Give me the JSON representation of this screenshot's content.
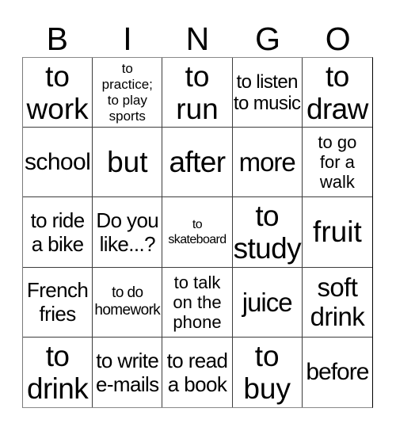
{
  "card": {
    "title": "BINGO",
    "header_letters": [
      "B",
      "I",
      "N",
      "G",
      "O"
    ],
    "colors": {
      "background": "#ffffff",
      "text": "#000000",
      "grid_line": "#3d3d3d"
    },
    "grid": {
      "rows": 5,
      "columns": 5,
      "rows_data": [
        {
          "cells": [
            {
              "text": "to\nwork"
            },
            {
              "text": "to\npractice;\nto play\nsports"
            },
            {
              "text": "to\nrun"
            },
            {
              "text": "to listen\nto music"
            },
            {
              "text": "to\ndraw"
            }
          ]
        },
        {
          "cells": [
            {
              "text": "school"
            },
            {
              "text": "but"
            },
            {
              "text": "after"
            },
            {
              "text": "more"
            },
            {
              "text": "to go\nfor a\nwalk"
            }
          ]
        },
        {
          "cells": [
            {
              "text": "to ride\na bike"
            },
            {
              "text": "Do you\nlike...?"
            },
            {
              "text": "to\nskateboard"
            },
            {
              "text": "to\nstudy"
            },
            {
              "text": "fruit"
            }
          ]
        },
        {
          "cells": [
            {
              "text": "French\nfries"
            },
            {
              "text": "to do\nhomework"
            },
            {
              "text": "to talk\non the\nphone"
            },
            {
              "text": "juice"
            },
            {
              "text": "soft\ndrink"
            }
          ]
        },
        {
          "cells": [
            {
              "text": "to\ndrink"
            },
            {
              "text": "to write\ne-mails"
            },
            {
              "text": "to read\na book"
            },
            {
              "text": "to\nbuy"
            },
            {
              "text": "before"
            }
          ]
        }
      ]
    }
  }
}
